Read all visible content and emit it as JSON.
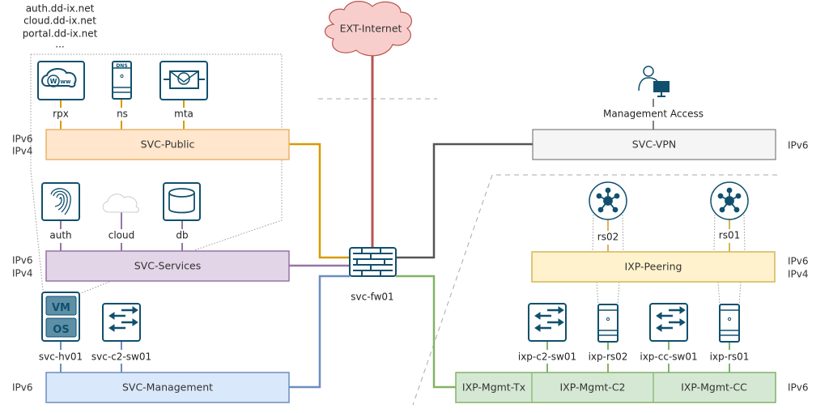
{
  "hostnames": [
    "auth.dd-ix.net",
    "cloud.dd-ix.net",
    "portal.dd-ix.net",
    "..."
  ],
  "internet": {
    "label": "EXT-Internet",
    "color": "#b85450"
  },
  "firewall": {
    "label": "svc-fw01"
  },
  "networks": {
    "svc_public": {
      "label": "SVC-Public",
      "ip": [
        "IPv6",
        "IPv4"
      ],
      "color": "#d79b00",
      "fill": "#ffe6cc"
    },
    "svc_services": {
      "label": "SVC-Services",
      "ip": [
        "IPv6",
        "IPv4"
      ],
      "color": "#9673a6",
      "fill": "#e1d5e7"
    },
    "svc_management": {
      "label": "SVC-Management",
      "ip": [
        "IPv6"
      ],
      "color": "#6c8ebf",
      "fill": "#dae8fc"
    },
    "svc_vpn": {
      "label": "SVC-VPN",
      "ip": [
        "IPv6"
      ],
      "color": "#666666",
      "fill": "#f5f5f5"
    },
    "ixp_peering": {
      "label": "IXP-Peering",
      "ip": [
        "IPv6",
        "IPv4"
      ],
      "color": "#d6b656",
      "fill": "#fff2cc"
    },
    "ixp_mgmt": {
      "segments": [
        "IXP-Mgmt-Tx",
        "IXP-Mgmt-C2",
        "IXP-Mgmt-CC"
      ],
      "ip": [
        "IPv6"
      ],
      "color": "#82b366",
      "fill": "#d5e8d4"
    }
  },
  "public_hosts": [
    {
      "label": "rpx",
      "icon": "www-icon"
    },
    {
      "label": "ns",
      "icon": "dns-server-icon"
    },
    {
      "label": "mta",
      "icon": "mail-icon"
    }
  ],
  "service_hosts": [
    {
      "label": "auth",
      "icon": "fingerprint-icon"
    },
    {
      "label": "cloud",
      "icon": "cloud-icon"
    },
    {
      "label": "db",
      "icon": "database-icon"
    }
  ],
  "mgmt_hosts": [
    {
      "label": "svc-hv01",
      "icon": "vm-os-icon",
      "vm": "VM",
      "os": "OS"
    },
    {
      "label": "svc-c2-sw01",
      "icon": "switch-icon"
    }
  ],
  "management_access": {
    "label": "Management Access",
    "icon": "user-workstation-icon"
  },
  "route_servers": [
    {
      "label": "rs02"
    },
    {
      "label": "rs01"
    }
  ],
  "ixp_hosts": [
    {
      "label": "ixp-c2-sw01",
      "icon": "switch-icon"
    },
    {
      "label": "ixp-rs02",
      "icon": "server-icon"
    },
    {
      "label": "ixp-cc-sw01",
      "icon": "switch-icon"
    },
    {
      "label": "ixp-rs01",
      "icon": "server-icon"
    }
  ]
}
